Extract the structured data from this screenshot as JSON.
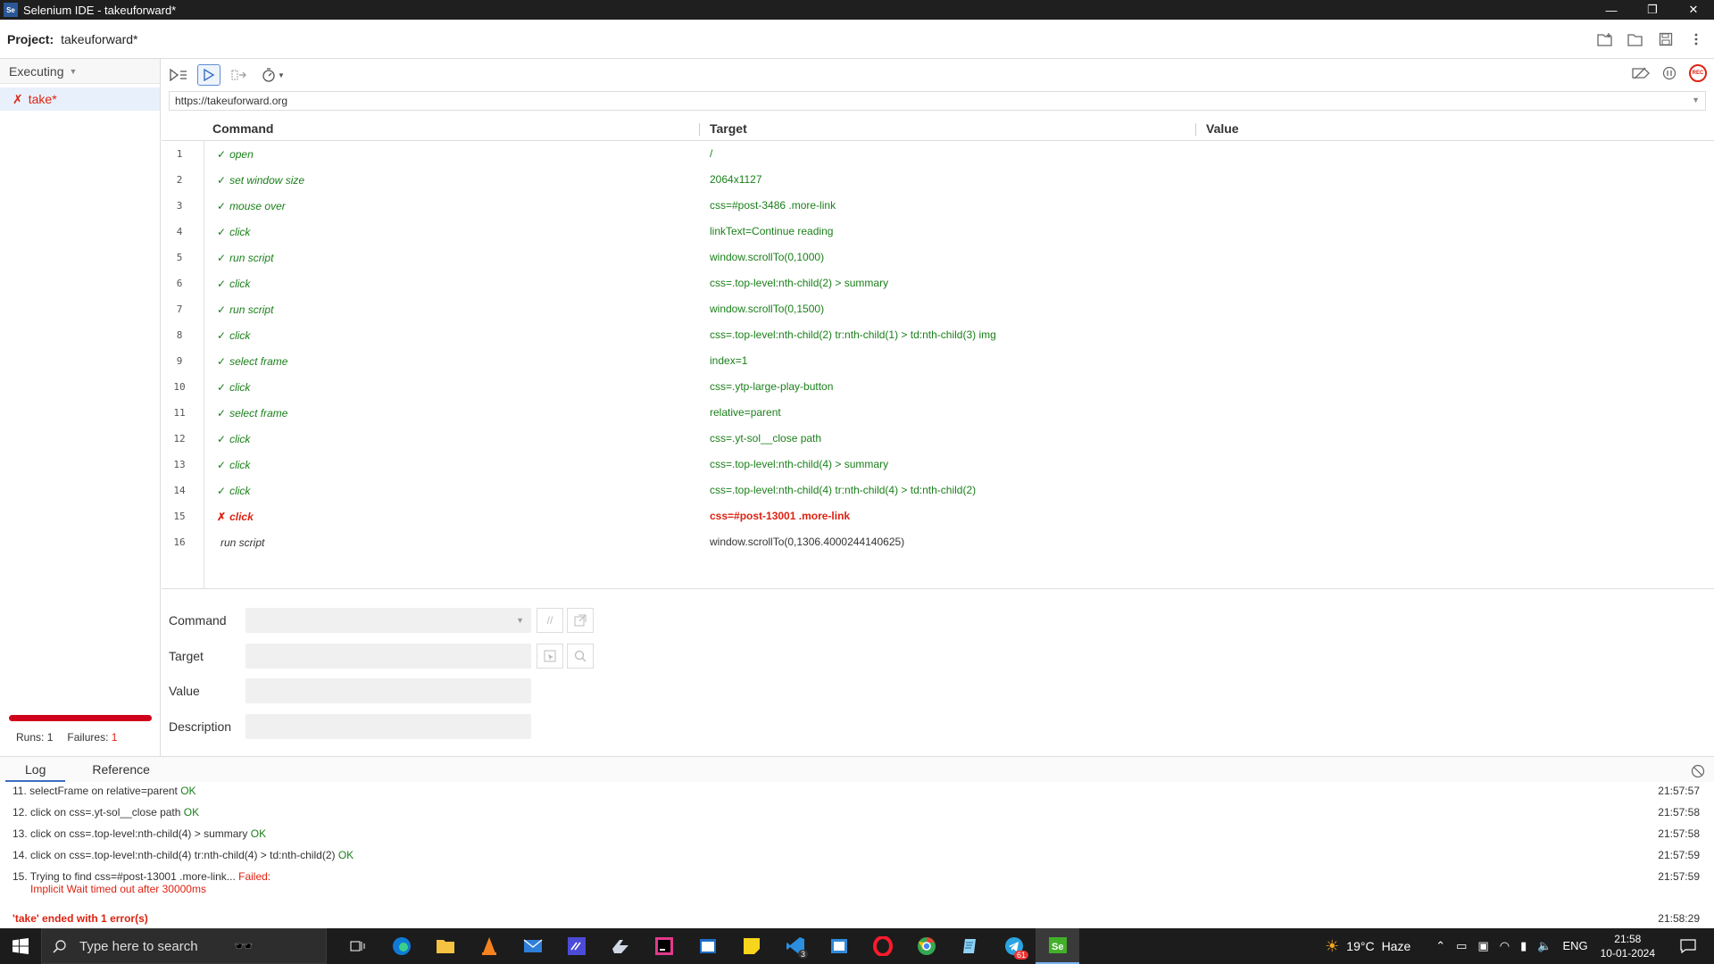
{
  "window": {
    "app_icon": "Se",
    "title": "Selenium IDE - takeuforward*",
    "controls": [
      "—",
      "❐",
      "✕"
    ]
  },
  "project": {
    "label": "Project:",
    "name": "takeuforward*"
  },
  "sidebar": {
    "mode": "Executing",
    "tests": [
      {
        "name": "take*",
        "status": "failed"
      }
    ],
    "runs_label": "Runs:",
    "runs": "1",
    "failures_label": "Failures:",
    "failures": "1",
    "progress": 1.0,
    "progress_color": "#d0021b"
  },
  "url": "https://takeuforward.org",
  "columns": {
    "command": "Command",
    "target": "Target",
    "value": "Value"
  },
  "commands": [
    {
      "n": "1",
      "mark": "✓",
      "cmd": "open",
      "target": "/",
      "status": "pass"
    },
    {
      "n": "2",
      "mark": "✓",
      "cmd": "set window size",
      "target": "2064x1127",
      "status": "pass"
    },
    {
      "n": "3",
      "mark": "✓",
      "cmd": "mouse over",
      "target": "css=#post-3486 .more-link",
      "status": "pass"
    },
    {
      "n": "4",
      "mark": "✓",
      "cmd": "click",
      "target": "linkText=Continue reading",
      "status": "pass"
    },
    {
      "n": "5",
      "mark": "✓",
      "cmd": "run script",
      "target": "window.scrollTo(0,1000)",
      "status": "pass"
    },
    {
      "n": "6",
      "mark": "✓",
      "cmd": "click",
      "target": "css=.top-level:nth-child(2) > summary",
      "status": "pass"
    },
    {
      "n": "7",
      "mark": "✓",
      "cmd": "run script",
      "target": "window.scrollTo(0,1500)",
      "status": "pass"
    },
    {
      "n": "8",
      "mark": "✓",
      "cmd": "click",
      "target": "css=.top-level:nth-child(2) tr:nth-child(1) > td:nth-child(3) img",
      "status": "pass"
    },
    {
      "n": "9",
      "mark": "✓",
      "cmd": "select frame",
      "target": "index=1",
      "status": "pass"
    },
    {
      "n": "10",
      "mark": "✓",
      "cmd": "click",
      "target": "css=.ytp-large-play-button",
      "status": "pass"
    },
    {
      "n": "11",
      "mark": "✓",
      "cmd": "select frame",
      "target": "relative=parent",
      "status": "pass"
    },
    {
      "n": "12",
      "mark": "✓",
      "cmd": "click",
      "target": "css=.yt-sol__close path",
      "status": "pass"
    },
    {
      "n": "13",
      "mark": "✓",
      "cmd": "click",
      "target": "css=.top-level:nth-child(4) > summary",
      "status": "pass"
    },
    {
      "n": "14",
      "mark": "✓",
      "cmd": "click",
      "target": "css=.top-level:nth-child(4) tr:nth-child(4) > td:nth-child(2)",
      "status": "pass"
    },
    {
      "n": "15",
      "mark": "✗",
      "cmd": "click",
      "target": "css=#post-13001 .more-link",
      "status": "fail"
    },
    {
      "n": "16",
      "mark": "",
      "cmd": "run script",
      "target": "window.scrollTo(0,1306.4000244140625)",
      "status": "pending"
    }
  ],
  "editor": {
    "command_label": "Command",
    "target_label": "Target",
    "value_label": "Value",
    "description_label": "Description",
    "comment_btn": "//"
  },
  "log": {
    "tabs": [
      "Log",
      "Reference"
    ],
    "lines": [
      {
        "text": "11. selectFrame on relative=parent ",
        "status": "OK",
        "time": "21:57:57"
      },
      {
        "text": "12. click on css=.yt-sol__close path ",
        "status": "OK",
        "time": "21:57:58"
      },
      {
        "text": "13. click on css=.top-level:nth-child(4) > summary ",
        "status": "OK",
        "time": "21:57:58"
      },
      {
        "text": "14. click on css=.top-level:nth-child(4) tr:nth-child(4) > td:nth-child(2) ",
        "status": "OK",
        "time": "21:57:59"
      },
      {
        "text": "15. Trying to find css=#post-13001 .more-link... ",
        "status": "Failed:",
        "detail": "Implicit Wait timed out after 30000ms",
        "time": "21:57:59"
      }
    ],
    "final": {
      "text": "'take' ended with 1 error(s)",
      "time": "21:58:29"
    }
  },
  "taskbar": {
    "search_placeholder": "Type here to search",
    "apps": [
      "task-view",
      "edge",
      "file-explorer",
      "vlc",
      "mail",
      "visual-studio",
      "onedrive",
      "intellij",
      "app-window",
      "sticky-notes",
      "vscode",
      "app-window-2",
      "opera",
      "chrome",
      "notepad",
      "telegram",
      "selenium-ide"
    ],
    "badges": {
      "vscode": "3",
      "telegram": "61"
    },
    "weather_temp": "19°C",
    "weather_desc": "Haze",
    "lang": "ENG",
    "time": "21:58",
    "date": "10-01-2024"
  }
}
